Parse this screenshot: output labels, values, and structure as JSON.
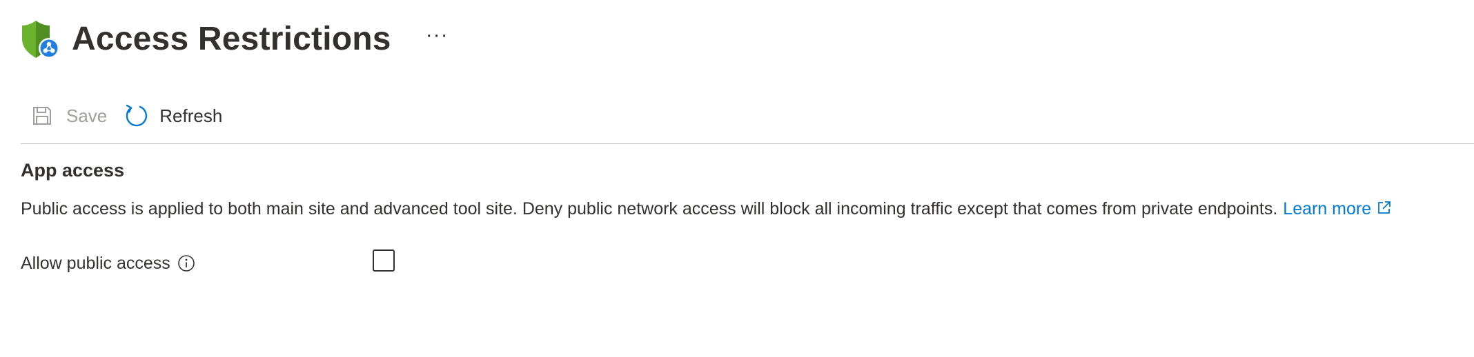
{
  "header": {
    "title": "Access Restrictions",
    "more_label": "···",
    "icon": "shield-network-icon"
  },
  "toolbar": {
    "save_label": "Save",
    "save_icon": "save-icon",
    "refresh_label": "Refresh",
    "refresh_icon": "refresh-icon"
  },
  "section": {
    "title": "App access",
    "description": "Public access is applied to both main site and advanced tool site. Deny public network access will block all incoming traffic except that comes from private endpoints.",
    "learn_more": "Learn more",
    "learn_more_icon": "external-link-icon"
  },
  "fields": {
    "allow_public_access": {
      "label": "Allow public access",
      "checked": false,
      "info_icon": "info-icon"
    }
  },
  "colors": {
    "accent": "#0078d4",
    "shield": "#5ea32b",
    "text": "#323130",
    "disabled": "#a19f9d"
  }
}
